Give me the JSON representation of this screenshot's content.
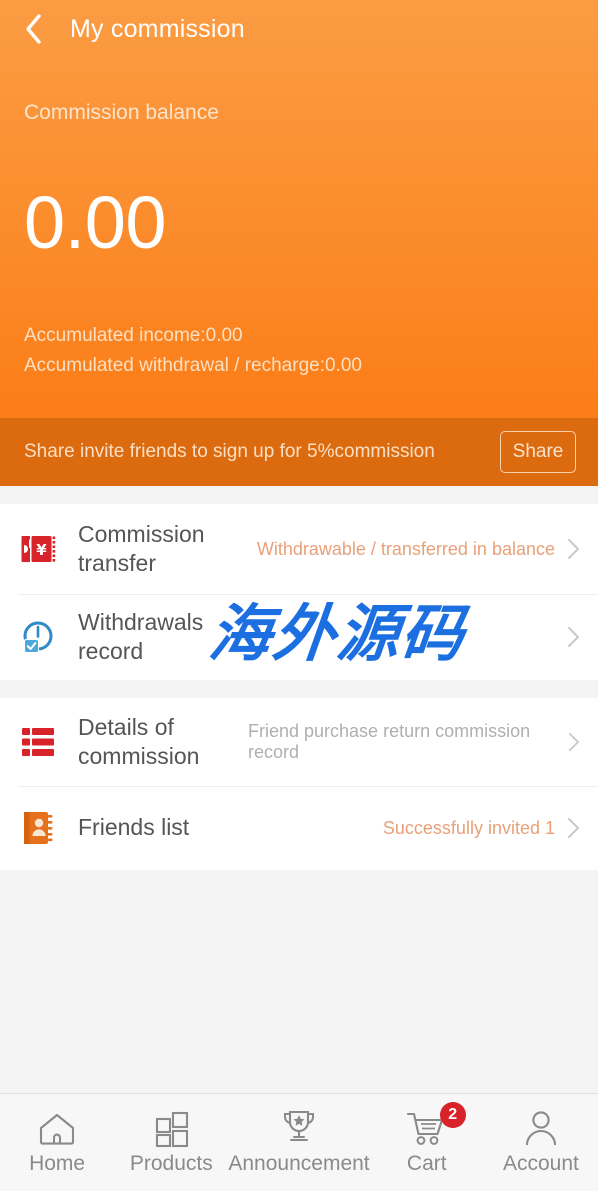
{
  "header": {
    "back_icon": "chevron-left-icon",
    "title": "My commission"
  },
  "balance": {
    "label": "Commission balance",
    "amount": "0.00",
    "accumulated_income": "Accumulated income:0.00",
    "accumulated_withdrawal": "Accumulated withdrawal / recharge:0.00"
  },
  "share": {
    "text": "Share invite friends to sign up for 5%commission",
    "button_label": "Share"
  },
  "watermark": {
    "text": "海外源码",
    "color": "#1C6FE0"
  },
  "menu_groups": [
    {
      "items": [
        {
          "icon": "coupon-yen-icon",
          "label": "Commission transfer",
          "hint": "Withdrawable / transferred in balance",
          "hint_style": "orange",
          "chevron": "chevron-right-icon"
        },
        {
          "icon": "clock-check-icon",
          "label": "Withdrawals record",
          "hint": "",
          "hint_style": "orange",
          "chevron": "chevron-right-icon"
        }
      ]
    },
    {
      "items": [
        {
          "icon": "list-rows-icon",
          "label": "Details of commission",
          "hint": "Friend purchase return commission record",
          "hint_style": "grey",
          "chevron": "chevron-right-icon"
        },
        {
          "icon": "address-book-icon",
          "label": "Friends list",
          "hint": "Successfully invited 1",
          "hint_style": "orange",
          "chevron": "chevron-right-icon"
        }
      ]
    }
  ],
  "tabbar": [
    {
      "icon": "home-icon",
      "label": "Home",
      "badge": ""
    },
    {
      "icon": "grid-icon",
      "label": "Products",
      "badge": ""
    },
    {
      "icon": "trophy-star-icon",
      "label": "Announcement",
      "badge": ""
    },
    {
      "icon": "cart-icon",
      "label": "Cart",
      "badge": "2"
    },
    {
      "icon": "person-icon",
      "label": "Account",
      "badge": ""
    }
  ],
  "colors": {
    "hero_top": "#FB9C43",
    "hero_bottom": "#FB7D17",
    "share_banner": "#DC6B10",
    "hint_orange": "#E9A079",
    "hint_grey": "#AFAFAF",
    "badge_red": "#D8232A"
  }
}
